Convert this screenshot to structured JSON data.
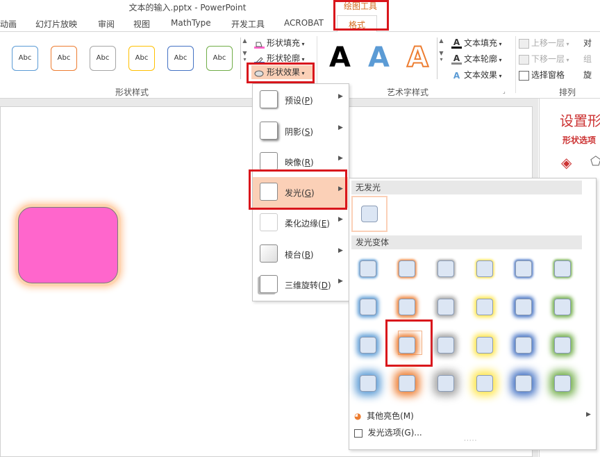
{
  "window": {
    "title": "文本的输入.pptx - PowerPoint"
  },
  "contextual": {
    "label": "绘图工具",
    "tab": "格式"
  },
  "tabs": [
    "动画",
    "幻灯片放映",
    "审阅",
    "视图",
    "MathType",
    "开发工具",
    "ACROBAT"
  ],
  "shape_styles": {
    "swatch_label": "Abc",
    "swatches": [
      "#5b9bd5",
      "#ed7d31",
      "#a5a5a5",
      "#ffc000",
      "#4472c4",
      "#70ad47"
    ],
    "fill": "形状填充",
    "outline": "形状轮廓",
    "effects": "形状效果",
    "group": "形状样式"
  },
  "wordart": {
    "letters": [
      "A",
      "A",
      "A"
    ],
    "fill": "文本填充",
    "outline": "文本轮廓",
    "effects": "文本效果",
    "group": "艺术字样式"
  },
  "arrange": {
    "bring_forward": "上移一层",
    "send_backward": "下移一层",
    "selection_pane": "选择窗格",
    "group": "排列",
    "cut1": "对",
    "cut2": "组",
    "cut3": "旋"
  },
  "right_pane": {
    "title": "设置形",
    "subtitle": "形状选项"
  },
  "effects_menu": [
    {
      "label": "预设(",
      "key": "P",
      "end": ")"
    },
    {
      "label": "阴影(",
      "key": "S",
      "end": ")"
    },
    {
      "label": "映像(",
      "key": "R",
      "end": ")"
    },
    {
      "label": "发光(",
      "key": "G",
      "end": ")"
    },
    {
      "label": "柔化边缘(",
      "key": "E",
      "end": ")"
    },
    {
      "label": "棱台(",
      "key": "B",
      "end": ")"
    },
    {
      "label": "三维旋转(",
      "key": "D",
      "end": ")"
    }
  ],
  "glow": {
    "no_glow": "无发光",
    "variants": "发光变体",
    "colors": [
      "#5b9bd5",
      "#ed7d31",
      "#a5a5a5",
      "#ffe64d",
      "#4472c4",
      "#70ad47"
    ],
    "more_colors": "其他亮色(M)",
    "options": "发光选项(G)..."
  },
  "colors": {
    "accent": "#d26a1e",
    "highlight": "#d9161c",
    "hover": "#fbd0b7",
    "shape_fill": "#ff66cc"
  }
}
